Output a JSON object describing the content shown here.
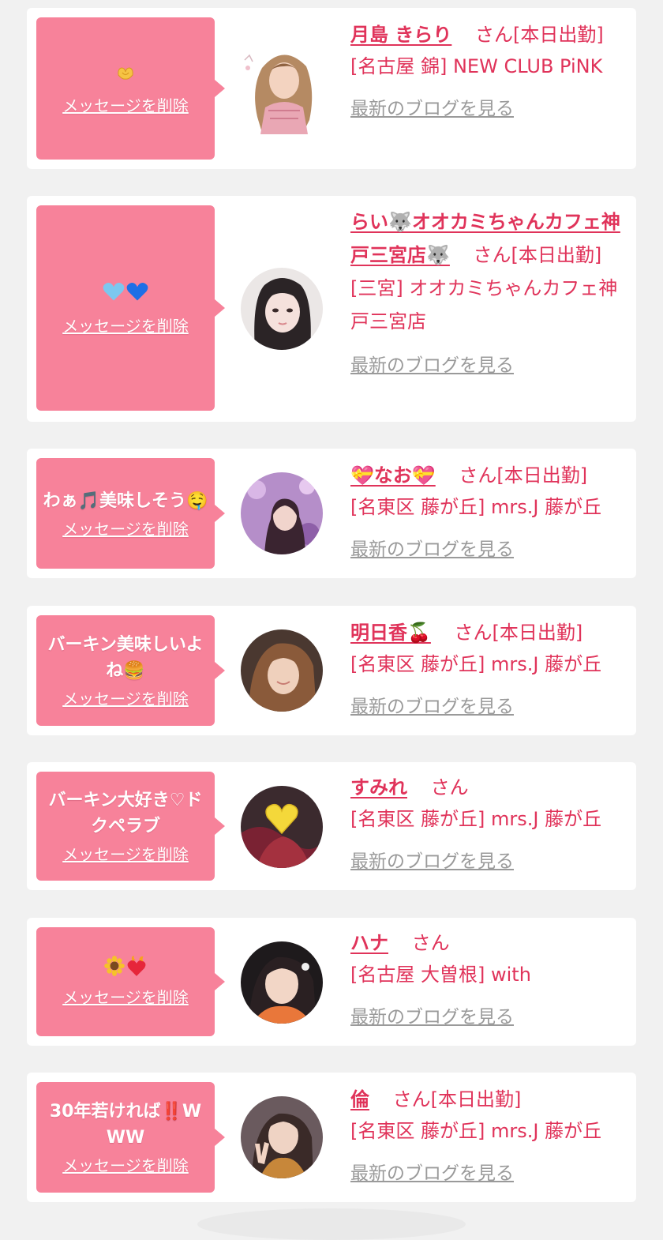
{
  "delete_label": "メッセージを削除",
  "blog_label": "最新のブログを見る",
  "san_label": "さん",
  "colors": {
    "bubble": "#f7829a",
    "accent": "#e0335a",
    "link_gray": "#9a9a9a",
    "background": "#f1f1f1"
  },
  "items": [
    {
      "message": "🫶",
      "name": "月島 きらり",
      "status": "[本日出勤]",
      "shop": "[名古屋 錦] NEW CLUB PiNK"
    },
    {
      "message": "🩵💙",
      "name": "らい🐺オオカミちゃんカフェ神戸三宮店🐺",
      "status": "[本日出勤]",
      "shop": "[三宮] オオカミちゃんカフェ神戸三宮店"
    },
    {
      "message": "わぁ🎵美味しそう🤤",
      "name": "💝なお💝",
      "status": "[本日出勤]",
      "shop": "[名東区 藤が丘] mrs.J 藤が丘"
    },
    {
      "message": "バーキン美味しいよね🍔",
      "name": "明日香🍒",
      "status": "[本日出勤]",
      "shop": "[名東区 藤が丘] mrs.J 藤が丘"
    },
    {
      "message": "バーキン大好き♡ドクペラブ",
      "name": "すみれ",
      "status": "",
      "shop": "[名東区 藤が丘] mrs.J 藤が丘"
    },
    {
      "message": "🌻❤️‍🔥",
      "name": "ハナ",
      "status": "",
      "shop": "[名古屋 大曽根] with"
    },
    {
      "message": "30年若ければ‼️WWW",
      "name": "倫",
      "status": "[本日出勤]",
      "shop": "[名東区 藤が丘] mrs.J 藤が丘"
    }
  ]
}
